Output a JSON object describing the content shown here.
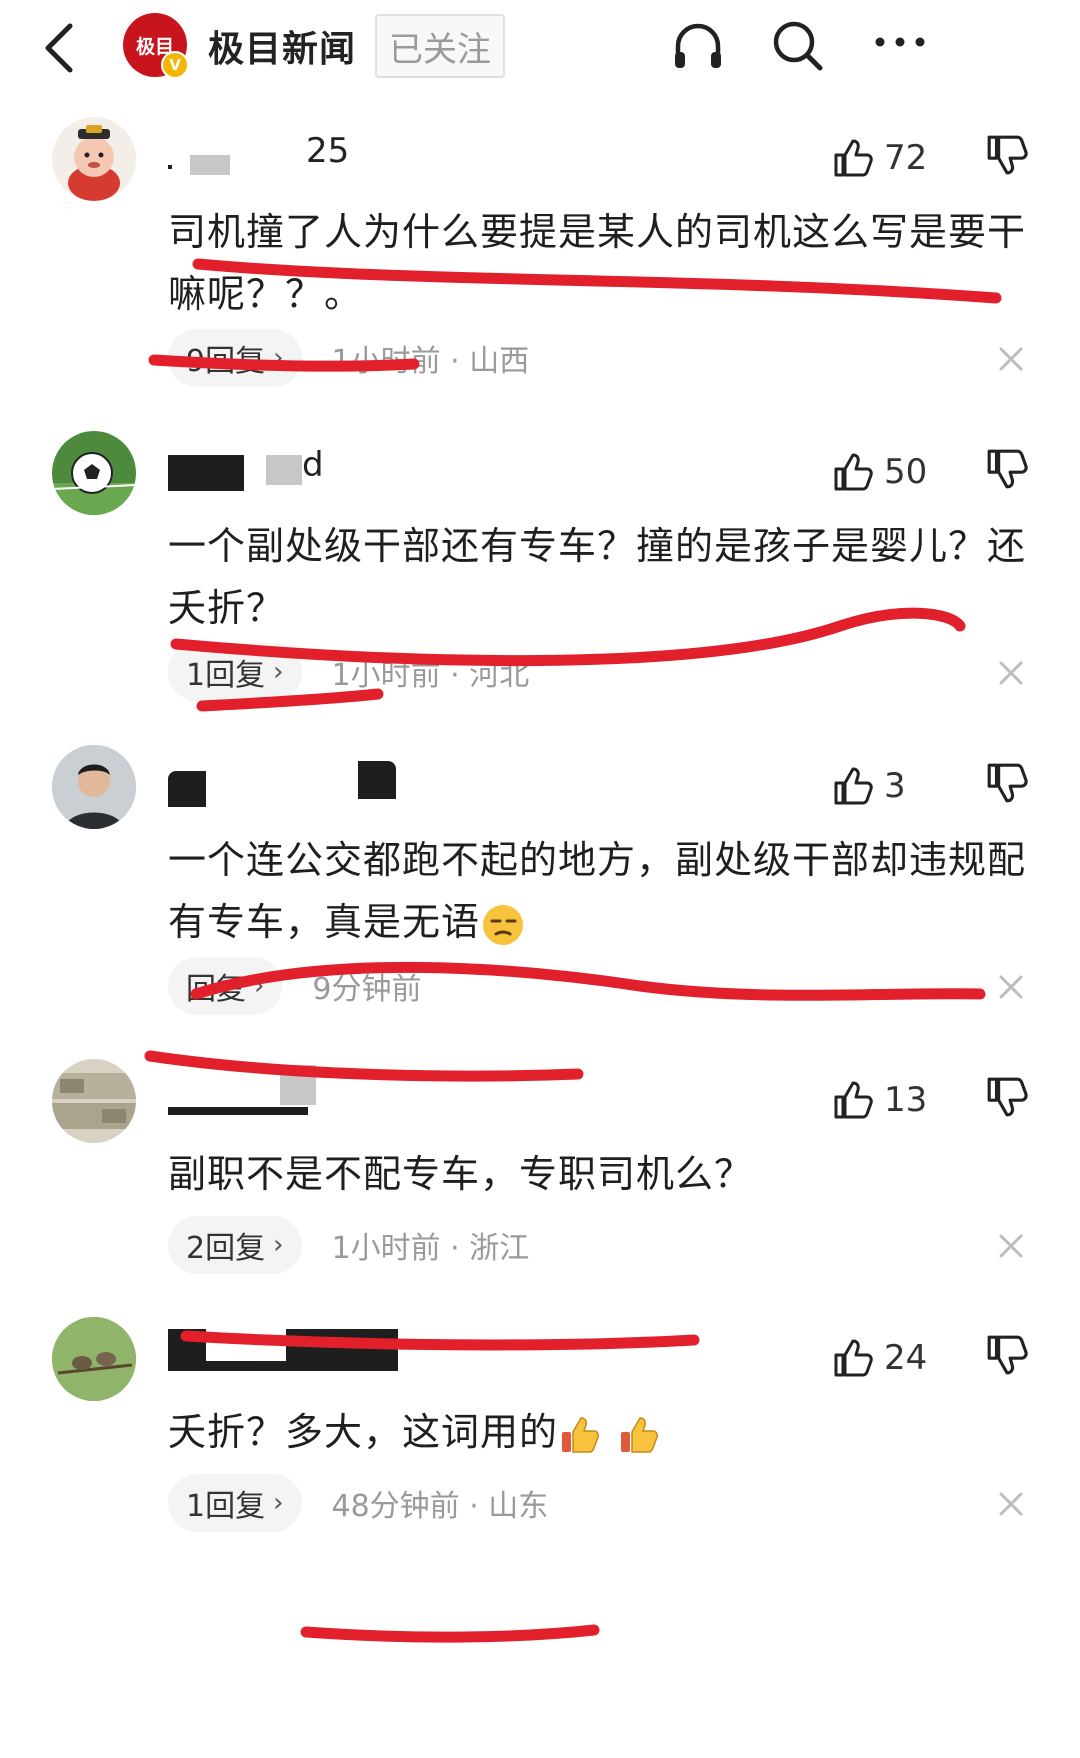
{
  "header": {
    "account_name": "极目新闻",
    "logo_text": "极目",
    "verified_badge": "V",
    "follow_label": "已关注",
    "icons": [
      "back-arrow-icon",
      "headphones-icon",
      "search-icon",
      "more-icon"
    ]
  },
  "colors": {
    "highlight": "#e2202c",
    "logo_red": "#c8141d",
    "verified": "#f2b705"
  },
  "comments": [
    {
      "user_fragment": "25",
      "likes": "72",
      "text": "司机撞了人为什么要提是某人的司机这么写是要干嘛呢？？。",
      "reply_label": "9回复",
      "time": "1小时前 · 山西"
    },
    {
      "user_fragment": "d",
      "likes": "50",
      "text": "一个副处级干部还有专车？撞的是孩子是婴儿？还夭折？",
      "reply_label": "1回复",
      "time": "1小时前 · 河北"
    },
    {
      "user_fragment": "",
      "likes": "3",
      "text": "一个连公交都跑不起的地方，副处级干部却违规配有专车，真是无语",
      "reply_label": "回复",
      "time": "9分钟前"
    },
    {
      "user_fragment": "",
      "likes": "13",
      "text": "副职不是不配专车，专职司机么？",
      "reply_label": "2回复",
      "time": "1小时前 · 浙江"
    },
    {
      "user_fragment": "",
      "likes": "24",
      "text": "夭折？多大，这词用的",
      "reply_label": "1回复",
      "time": "48分钟前 · 山东"
    }
  ]
}
